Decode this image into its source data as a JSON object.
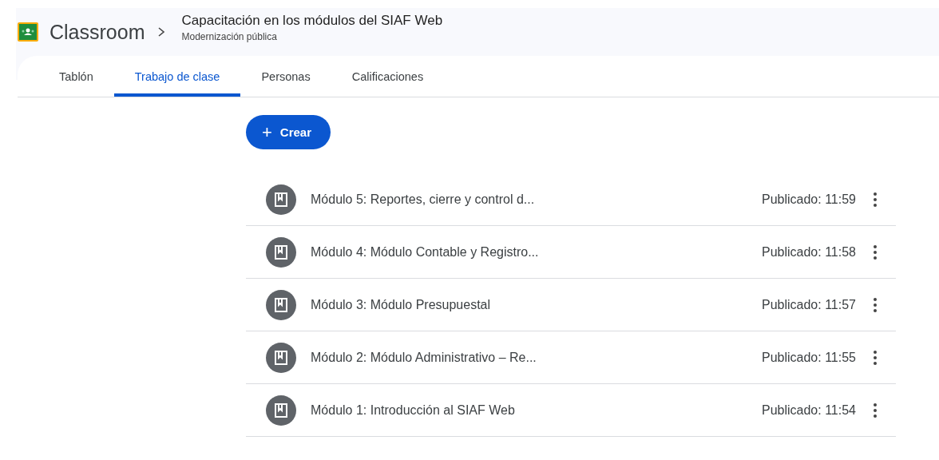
{
  "app": {
    "name": "Classroom"
  },
  "course": {
    "title": "Capacitación en los módulos del SIAF Web",
    "subtitle": "Modernización pública"
  },
  "tabs": [
    {
      "label": "Tablón",
      "selected": false
    },
    {
      "label": "Trabajo de clase",
      "selected": true
    },
    {
      "label": "Personas",
      "selected": false
    },
    {
      "label": "Calificaciones",
      "selected": false
    }
  ],
  "create_button": {
    "icon": "+",
    "label": "Crear"
  },
  "topics": [
    {
      "title": "Módulo 5: Reportes, cierre y control d...",
      "posted": "Publicado: 11:59"
    },
    {
      "title": "Módulo 4: Módulo Contable y Registro...",
      "posted": "Publicado: 11:58"
    },
    {
      "title": "Módulo 3: Módulo Presupuestal",
      "posted": "Publicado: 11:57"
    },
    {
      "title": "Módulo 2: Módulo Administrativo – Re...",
      "posted": "Publicado: 11:55"
    },
    {
      "title": "Módulo 1: Introducción al SIAF Web",
      "posted": "Publicado: 11:54"
    }
  ]
}
